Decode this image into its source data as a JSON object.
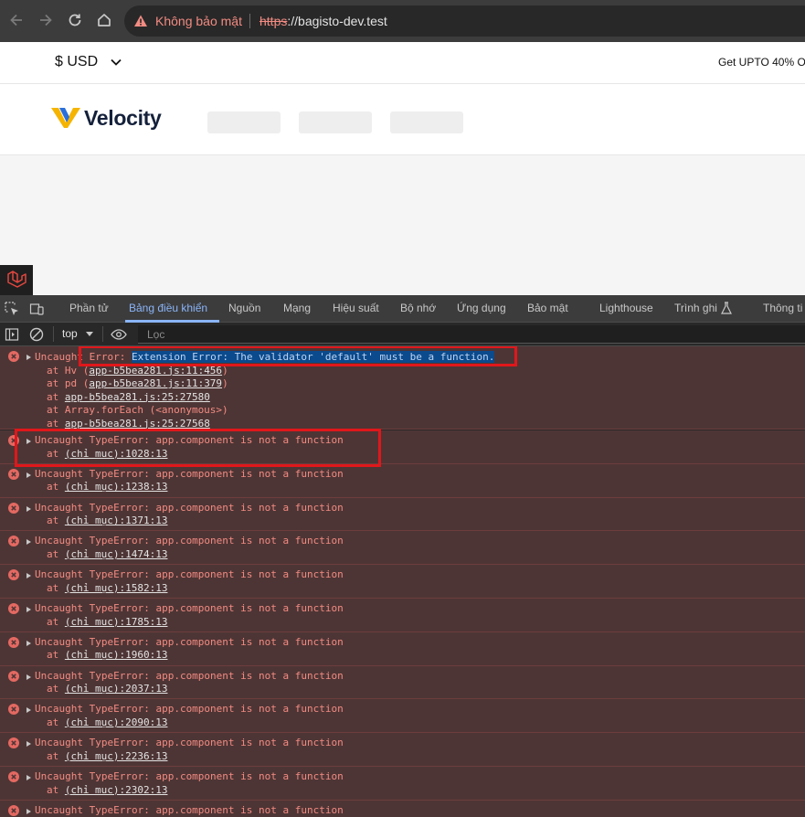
{
  "browser": {
    "security_label": "Không bảo mật",
    "url_scheme": "https",
    "url_rest": "://bagisto-dev.test"
  },
  "page": {
    "currency": "$ USD",
    "promo": "Get UPTO 40% O",
    "logo": "Velocity"
  },
  "devtools": {
    "tabs": [
      "Phần tử",
      "Bảng điều khiển",
      "Nguồn",
      "Mạng",
      "Hiệu suất",
      "Bộ nhớ",
      "Ứng dụng",
      "Bảo mật",
      "Lighthouse",
      "Trình ghi",
      "Thông ti"
    ],
    "active_tab": 1,
    "context": "top",
    "filter_placeholder": "Lọc"
  },
  "console": {
    "first_error": {
      "prefix": "Uncaught",
      "error_word": "Error:",
      "highlighted": "Extension Error: The validator 'default' must be a function.",
      "stack": [
        {
          "pre": "at Hv (",
          "link": "app-b5bea281.js:11:456",
          "post": ")"
        },
        {
          "pre": "at pd (",
          "link": "app-b5bea281.js:11:379",
          "post": ")"
        },
        {
          "pre": "at ",
          "link": "app-b5bea281.js:25:27580",
          "post": ""
        },
        {
          "pre": "at Array.forEach (<anonymous>)",
          "link": "",
          "post": ""
        },
        {
          "pre": "at ",
          "link": "app-b5bea281.js:25:27568",
          "post": ""
        }
      ]
    },
    "type_errors": [
      {
        "message": "Uncaught TypeError: app.component is not a function",
        "at": "at",
        "location": "(chỉ mục):1028:13"
      },
      {
        "message": "Uncaught TypeError: app.component is not a function",
        "at": "at",
        "location": "(chỉ mục):1238:13"
      },
      {
        "message": "Uncaught TypeError: app.component is not a function",
        "at": "at",
        "location": "(chỉ mục):1371:13"
      },
      {
        "message": "Uncaught TypeError: app.component is not a function",
        "at": "at",
        "location": "(chỉ mục):1474:13"
      },
      {
        "message": "Uncaught TypeError: app.component is not a function",
        "at": "at",
        "location": "(chỉ mục):1582:13"
      },
      {
        "message": "Uncaught TypeError: app.component is not a function",
        "at": "at",
        "location": "(chỉ mục):1785:13"
      },
      {
        "message": "Uncaught TypeError: app.component is not a function",
        "at": "at",
        "location": "(chỉ mục):1960:13"
      },
      {
        "message": "Uncaught TypeError: app.component is not a function",
        "at": "at",
        "location": "(chỉ mục):2037:13"
      },
      {
        "message": "Uncaught TypeError: app.component is not a function",
        "at": "at",
        "location": "(chỉ mục):2090:13"
      },
      {
        "message": "Uncaught TypeError: app.component is not a function",
        "at": "at",
        "location": "(chỉ mục):2236:13"
      },
      {
        "message": "Uncaught TypeError: app.component is not a function",
        "at": "at",
        "location": "(chỉ mục):2302:13"
      },
      {
        "message": "Uncaught TypeError: app.component is not a function",
        "at": "",
        "location": ""
      }
    ]
  },
  "icons": {
    "back": "back-arrow-icon",
    "forward": "forward-arrow-icon",
    "reload": "reload-icon",
    "home": "home-icon",
    "warning": "warning-triangle-icon",
    "error": "error-circle-icon"
  },
  "colors": {
    "error_text": "#f28b82",
    "error_bg": "#4e3535",
    "highlight_box": "#e0171b",
    "active_tab": "#8ab4f8",
    "logo_navy": "#15213b",
    "logo_yellow": "#f5b400",
    "logo_blue": "#2a6fdb"
  }
}
